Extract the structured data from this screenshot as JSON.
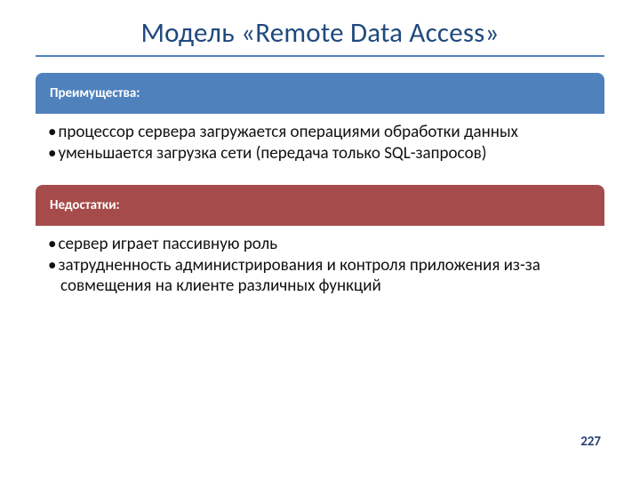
{
  "title": "Модель «Remote Data Access»",
  "advantages": {
    "header": "Преимущества:",
    "items": [
      "процессор сервера загружается операциями обработки данных",
      "уменьшается загрузка сети (передача только SQL-запросов)"
    ]
  },
  "disadvantages": {
    "header": "Недостатки:",
    "items": [
      "сервер играет пассивную роль",
      "затрудненность администрирования  и контроля приложения из-за  совмещения на клиенте различных функций"
    ]
  },
  "page_number": "227"
}
